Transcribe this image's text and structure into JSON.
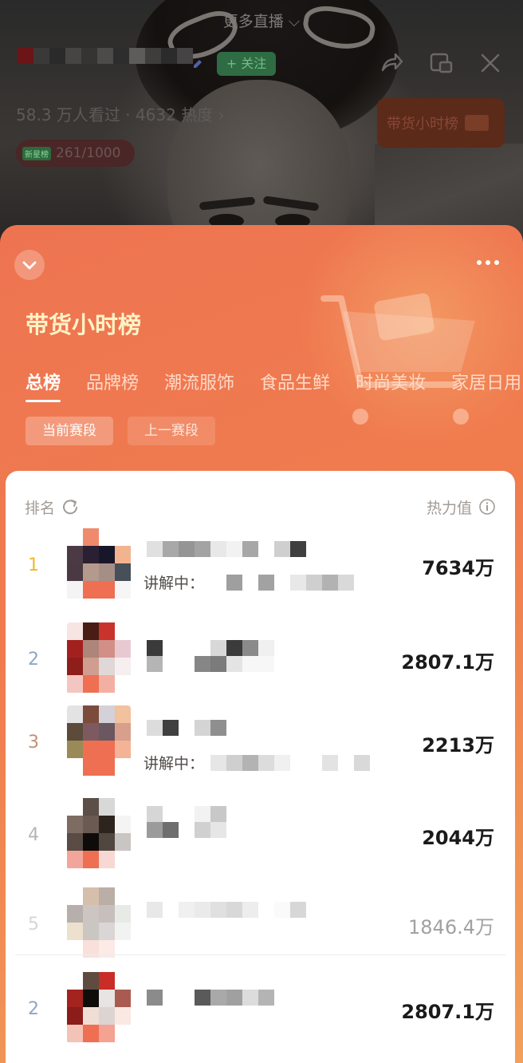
{
  "live": {
    "more_live": "更多直播 ⌵",
    "follow": "+ 关注",
    "viewers": "58.3 万人看过 · 4632 热度 ›",
    "pill_tag": "新星榜",
    "pill_text": "261/1000",
    "hot_badge": "带货小时榜"
  },
  "board": {
    "title": "带货小时榜",
    "tabs": [
      "总榜",
      "品牌榜",
      "潮流服饰",
      "食品生鲜",
      "时尚美妆",
      "家居日用"
    ],
    "segments": [
      "当前赛段",
      "上一赛段"
    ],
    "col_rank": "排名",
    "col_heat": "热力值"
  },
  "rows": [
    {
      "rank": "1",
      "heat": "7634万",
      "explain": "讲解中："
    },
    {
      "rank": "2",
      "heat": "2807.1万"
    },
    {
      "rank": "3",
      "heat": "2213万",
      "explain": "讲解中："
    },
    {
      "rank": "4",
      "heat": "2044万"
    },
    {
      "rank": "5",
      "heat": "1846.4万"
    },
    {
      "rank": "2",
      "heat": "2807.1万"
    }
  ],
  "colors": {
    "rank1": "#f4b72a",
    "rank2": "#8ea6c7",
    "rank3": "#c2907a",
    "rank_other": "#b5b5b5",
    "accent": "#ef6f4b"
  }
}
